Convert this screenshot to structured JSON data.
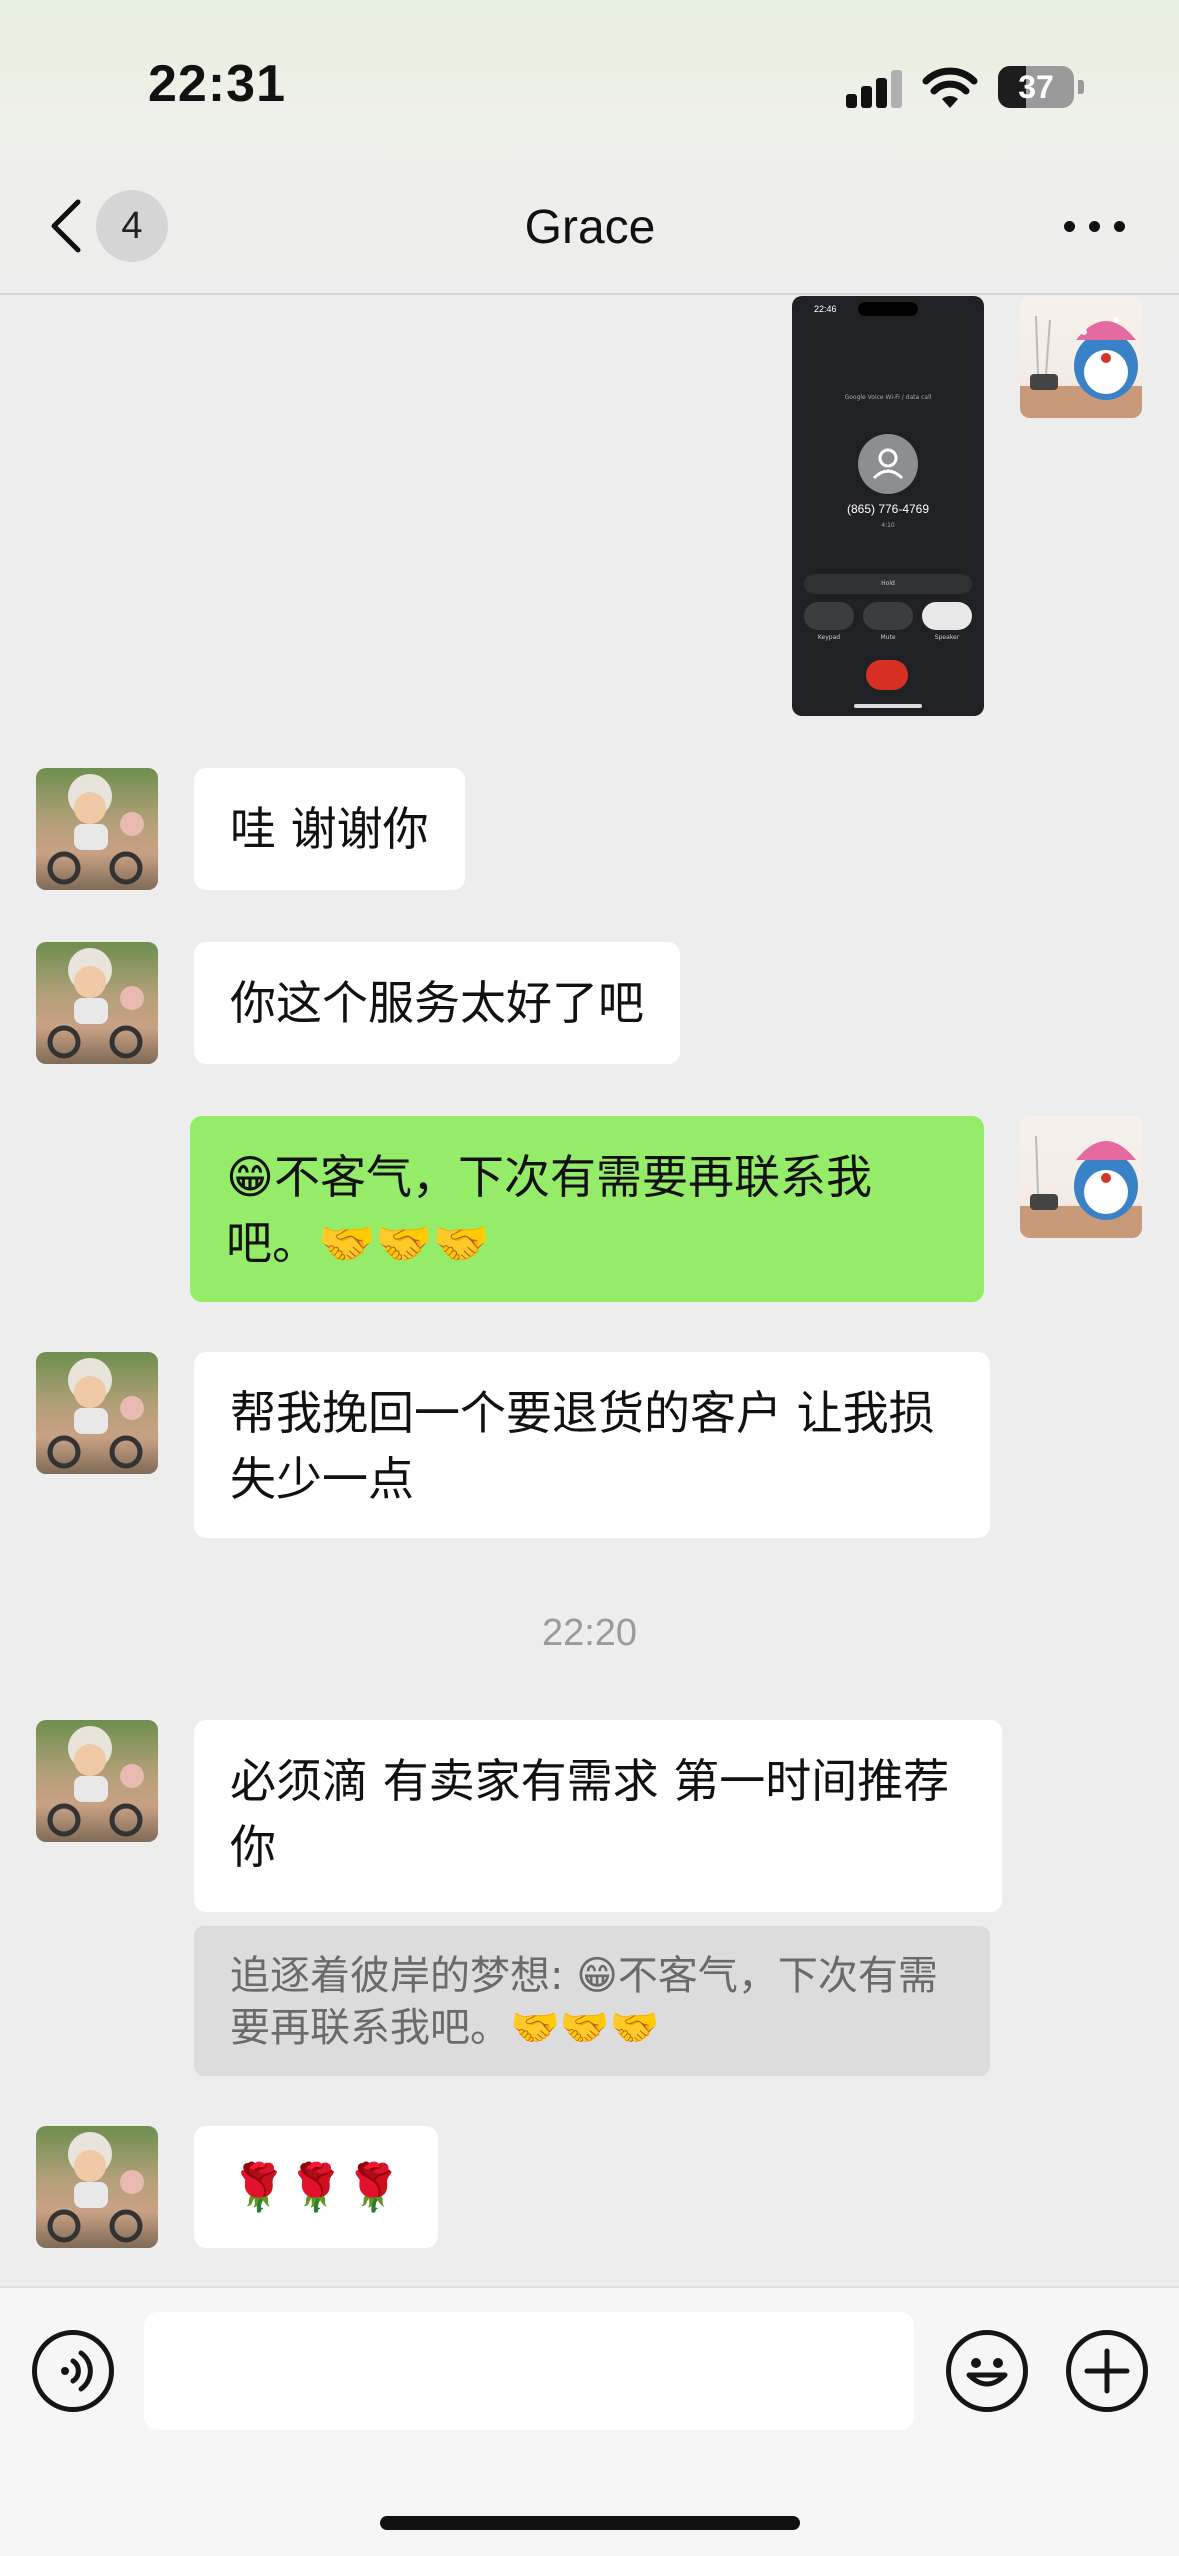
{
  "status_bar": {
    "time": "22:31",
    "battery": "37",
    "battery_level": 0.37
  },
  "header": {
    "unread_count": "4",
    "title": "Grace"
  },
  "image_message": {
    "time": "22:46",
    "subtitle": "Google Voice Wi-Fi / data call",
    "phone_number": "(865) 776-4769",
    "duration": "4:10",
    "hold_label": "Hold",
    "keypad_label": "Keypad",
    "mute_label": "Mute",
    "speaker_label": "Speaker"
  },
  "messages": [
    {
      "sender": "other",
      "text": "哇 谢谢你"
    },
    {
      "sender": "other",
      "text": "你这个服务太好了吧"
    },
    {
      "sender": "me",
      "text": "😁不客气，下次有需要再联系我吧。🤝🤝🤝"
    },
    {
      "sender": "other",
      "text": "帮我挽回一个要退货的客户 让我损失少一点"
    },
    {
      "sender": "other",
      "text": "必须滴 有卖家有需求 第一时间推荐你"
    },
    {
      "sender": "other",
      "text": "🌹🌹🌹"
    }
  ],
  "timestamp": "22:20",
  "quote": {
    "author": "追逐着彼岸的梦想",
    "text": "😁不客气，下次有需要再联系我吧。🤝🤝🤝"
  },
  "input": {
    "value": ""
  },
  "colors": {
    "outgoing_bubble": "#95ec69",
    "incoming_bubble": "#ffffff",
    "background": "#ededed"
  }
}
